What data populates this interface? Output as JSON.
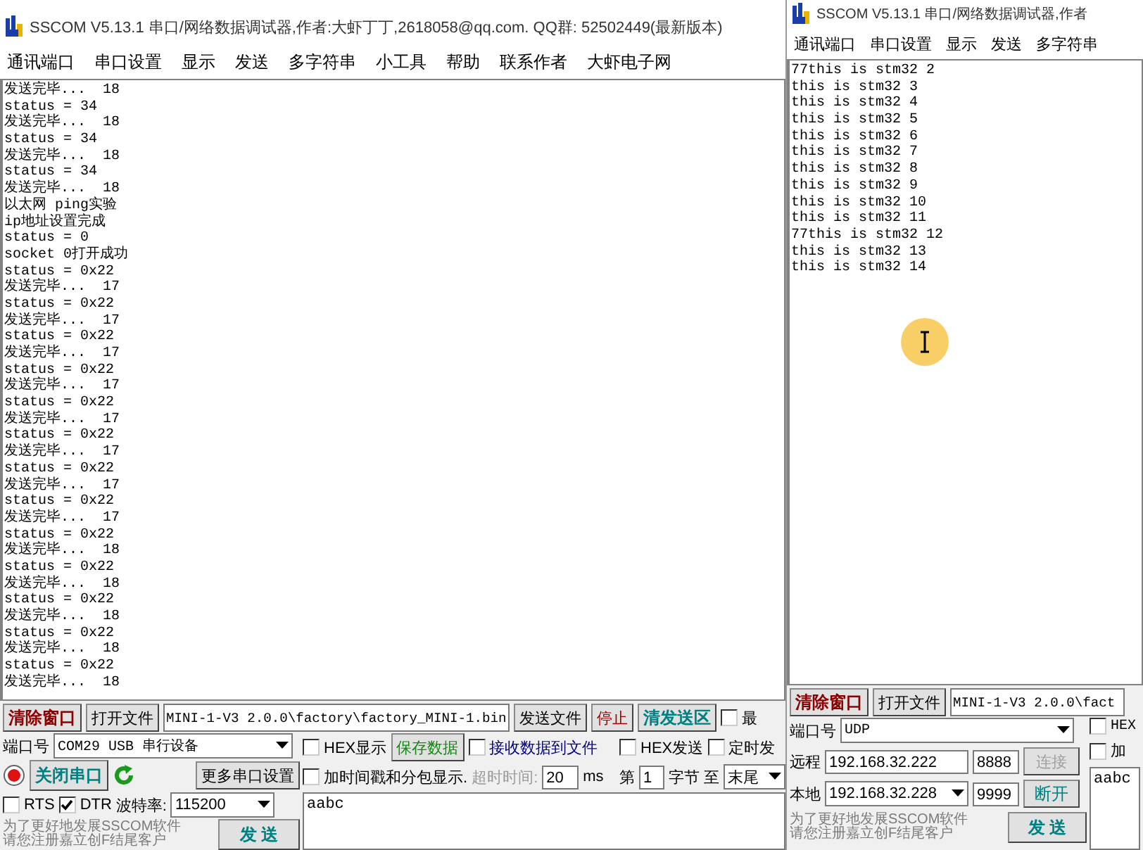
{
  "windows": [
    {
      "kind": "serial",
      "title": "SSCOM V5.13.1 串口/网络数据调试器,作者:大虾丁丁,2618058@qq.com. QQ群: 52502449(最新版本)",
      "menu": [
        "通讯端口",
        "串口设置",
        "显示",
        "发送",
        "多字符串",
        "小工具",
        "帮助",
        "联系作者",
        "大虾电子网"
      ],
      "receive_log": [
        "发送完毕...  18",
        "status = 34",
        "发送完毕...  18",
        "status = 34",
        "发送完毕...  18",
        "status = 34",
        "发送完毕...  18",
        "以太网 ping实验",
        "ip地址设置完成",
        "status = 0",
        "socket 0打开成功",
        "status = 0x22",
        "发送完毕...  17",
        "status = 0x22",
        "发送完毕...  17",
        "status = 0x22",
        "发送完毕...  17",
        "status = 0x22",
        "发送完毕...  17",
        "status = 0x22",
        "发送完毕...  17",
        "status = 0x22",
        "发送完毕...  17",
        "status = 0x22",
        "发送完毕...  17",
        "status = 0x22",
        "发送完毕...  17",
        "status = 0x22",
        "发送完毕...  18",
        "status = 0x22",
        "发送完毕...  18",
        "status = 0x22",
        "发送完毕...  18",
        "status = 0x22",
        "发送完毕...  18",
        "status = 0x22",
        "发送完毕...  18"
      ],
      "file_bar": {
        "clear_button": "清除窗口",
        "open_file_button": "打开文件",
        "file_path": "MINI-1-V3 2.0.0\\factory\\factory_MINI-1.bin",
        "send_file_button": "发送文件",
        "stop_button": "停止",
        "clear_send_button": "清发送区",
        "topmost": {
          "label": "最",
          "checked": false
        }
      },
      "port": {
        "label": "端口号",
        "value": "COM29 USB 串行设备"
      },
      "close_port_button": "关闭串口",
      "more_settings_button": "更多串口设置",
      "rts": {
        "label": "RTS",
        "checked": false
      },
      "dtr": {
        "label": "DTR",
        "checked": true
      },
      "baud": {
        "label": "波特率:",
        "value": "115200"
      },
      "promo": [
        "为了更好地发展SSCOM软件",
        "请您注册嘉立创F结尾客户"
      ],
      "send_button": "发 送",
      "hex_display": {
        "label": "HEX显示",
        "checked": false
      },
      "save_button": "保存数据",
      "receive_to_file": {
        "label": "接收数据到文件",
        "checked": false
      },
      "timestamp": {
        "label": "加时间戳和分包显示.",
        "checked": false
      },
      "timeout": {
        "label": "超时时间:",
        "value": "20",
        "unit": "ms",
        "disabled": true
      },
      "hex_send": {
        "label": "HEX发送",
        "checked": false
      },
      "timed_send": {
        "label": "定时发",
        "checked": false
      },
      "byte_range": {
        "prefix": "第",
        "value": "1",
        "unit": "字节",
        "to": "至",
        "end": "末尾"
      },
      "send_text": "aabc"
    },
    {
      "kind": "udp",
      "title": "SSCOM V5.13.1 串口/网络数据调试器,作者",
      "menu": [
        "通讯端口",
        "串口设置",
        "显示",
        "发送",
        "多字符串"
      ],
      "receive_log": [
        "77this is stm32 2",
        "this is stm32 3",
        "this is stm32 4",
        "this is stm32 5",
        "this is stm32 6",
        "this is stm32 7",
        "this is stm32 8",
        "this is stm32 9",
        "this is stm32 10",
        "this is stm32 11",
        "77this is stm32 12",
        "this is stm32 13",
        "this is stm32 14"
      ],
      "file_bar": {
        "clear_button": "清除窗口",
        "open_file_button": "打开文件",
        "file_path": "MINI-1-V3 2.0.0\\fact"
      },
      "port": {
        "label": "端口号",
        "value": "UDP"
      },
      "remote": {
        "label": "远程",
        "ip": "192.168.32.222",
        "port": "8888",
        "button": "连接",
        "disabled": true
      },
      "local": {
        "label": "本地",
        "ip": "192.168.32.228",
        "port": "9999",
        "button": "断开",
        "disabled": false
      },
      "promo": [
        "为了更好地发展SSCOM软件",
        "请您注册嘉立创F结尾客户"
      ],
      "send_button": "发 送",
      "hex_display": {
        "label": "HEX",
        "checked": false
      },
      "timestamp": {
        "label": "加",
        "checked": false
      },
      "send_text": "aabc"
    }
  ]
}
